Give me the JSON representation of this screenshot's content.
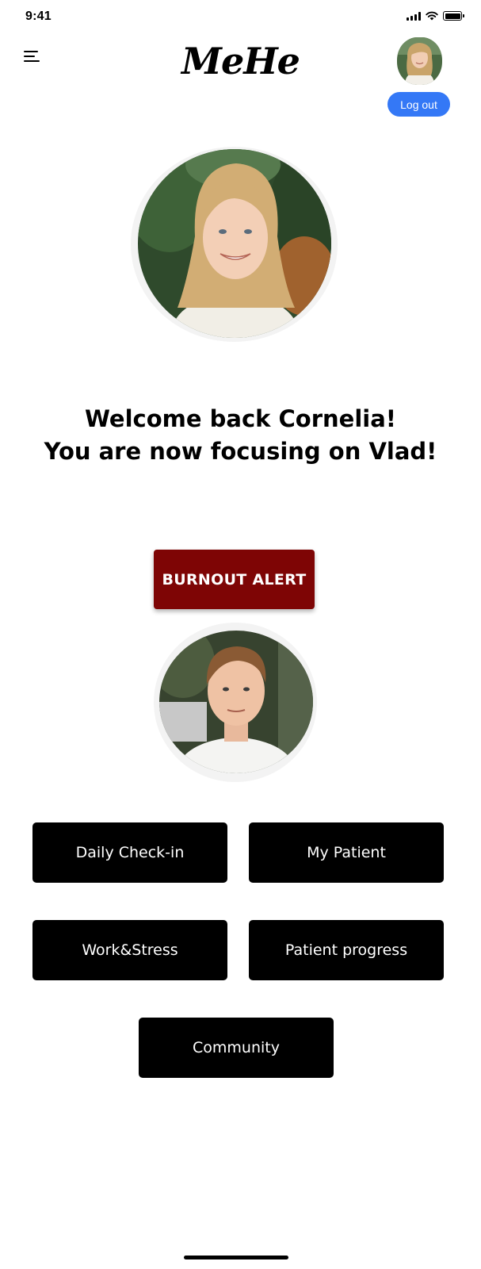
{
  "status_bar": {
    "time": "9:41",
    "icons": [
      "cellular-signal-icon",
      "wifi-icon",
      "battery-icon"
    ]
  },
  "header": {
    "menu_icon": "hamburger-menu-icon",
    "logo_text": "MeHe",
    "user_avatar": "caregiver-avatar",
    "logout_label": "Log out",
    "logout_color": "#3478f6"
  },
  "main": {
    "caregiver_photo": "caregiver-portrait",
    "welcome_line1": "Welcome back Cornelia!",
    "welcome_line2": "You are now focusing on Vlad!",
    "alert_label": "BURNOUT ALERT",
    "alert_color": "#7e0505",
    "patient_photo": "patient-portrait"
  },
  "nav": {
    "daily_checkin": "Daily Check-in",
    "my_patient": "My Patient",
    "work_stress": "Work&Stress",
    "patient_progress": "Patient progress",
    "community": "Community",
    "button_color": "#000000"
  }
}
